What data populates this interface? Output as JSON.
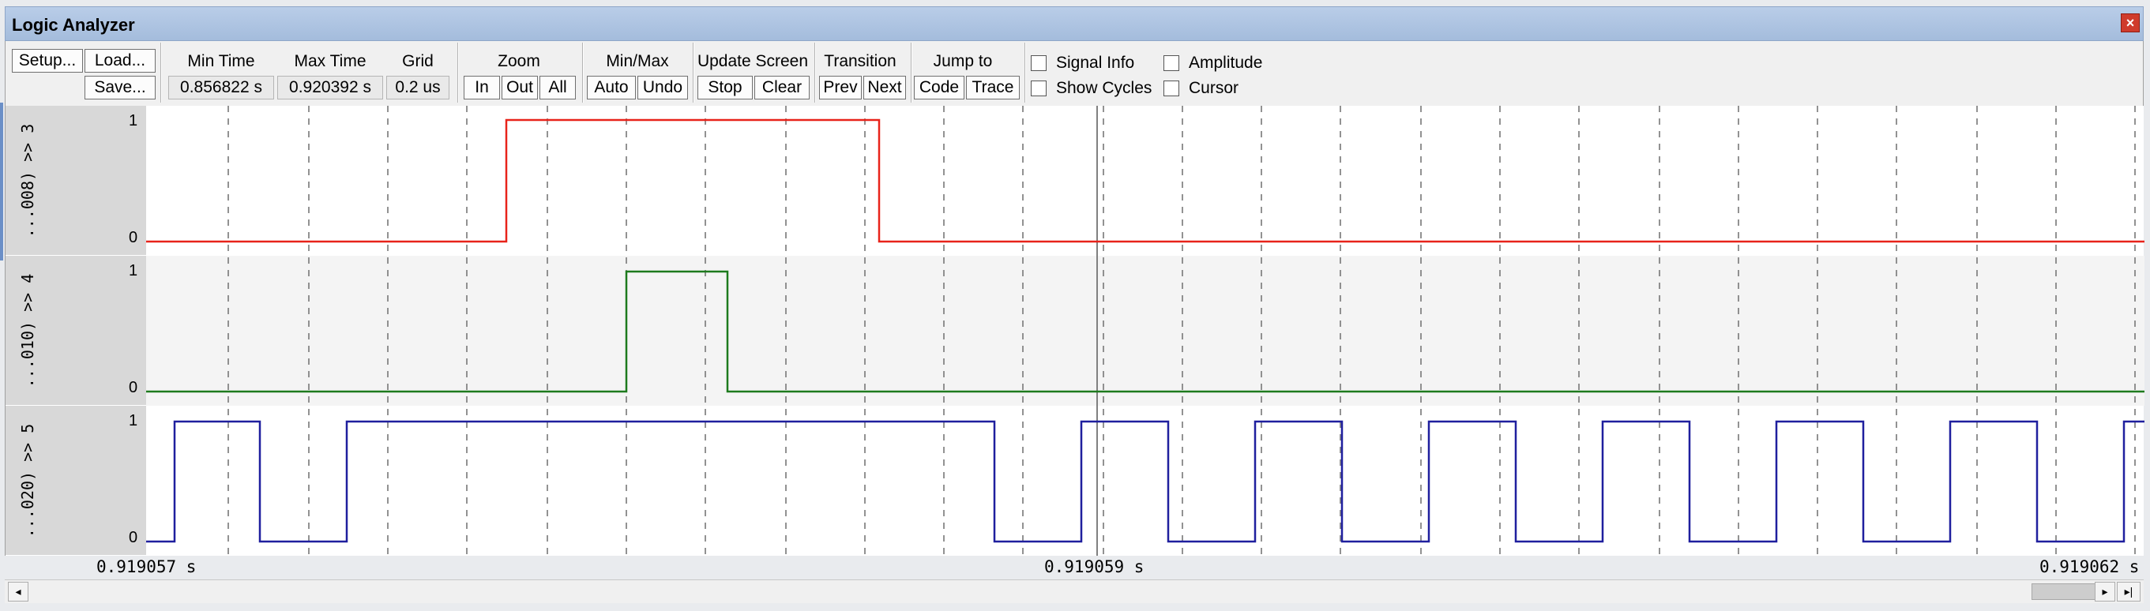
{
  "window": {
    "title": "Logic Analyzer",
    "close_glyph": "×",
    "close_icon": "close-icon"
  },
  "toolbar": {
    "setup_label": "Setup...",
    "load_label": "Load...",
    "save_label": "Save...",
    "min_time": {
      "label": "Min Time",
      "value": "0.856822 s"
    },
    "max_time": {
      "label": "Max Time",
      "value": "0.920392 s"
    },
    "grid": {
      "label": "Grid",
      "value": "0.2 us"
    },
    "zoom": {
      "label": "Zoom",
      "in": "In",
      "out": "Out",
      "all": "All"
    },
    "minmax": {
      "label": "Min/Max",
      "auto": "Auto",
      "undo": "Undo"
    },
    "update_screen": {
      "label": "Update Screen",
      "stop": "Stop",
      "clear": "Clear"
    },
    "transition": {
      "label": "Transition",
      "prev": "Prev",
      "next": "Next"
    },
    "jump_to": {
      "label": "Jump to",
      "code": "Code",
      "trace": "Trace"
    },
    "checkboxes": {
      "signal_info": "Signal Info",
      "show_cycles": "Show Cycles",
      "amplitude": "Amplitude",
      "cursor": "Cursor"
    }
  },
  "colors": {
    "sig1": "#e8231a",
    "sig2": "#1d7a1d",
    "sig3": "#1f1f9e",
    "grid": "#6e6e6e"
  },
  "signals": [
    {
      "name": "...008) >> 3",
      "level_high": "1",
      "level_low": "0"
    },
    {
      "name": "...010) >> 4",
      "level_high": "1",
      "level_low": "0"
    },
    {
      "name": "...020) >> 5",
      "level_high": "1",
      "level_low": "0"
    }
  ],
  "time_axis": {
    "left": "0.919057 s",
    "center": "0.919059 s",
    "right": "0.919062 s"
  },
  "scrollbar": {
    "left_glyph": "◂",
    "right_glyph": "▸",
    "end_glyph": "▸|"
  }
}
